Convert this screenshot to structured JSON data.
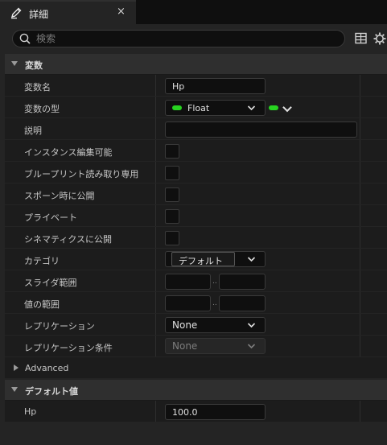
{
  "tab": {
    "title": "詳細",
    "close": "×"
  },
  "search": {
    "placeholder": "検索",
    "value": ""
  },
  "icons": {
    "tab": "pencil-icon",
    "search": "search-icon",
    "view": "grid-icon",
    "settings": "gear-icon"
  },
  "colors": {
    "accent_green": "#27d320",
    "background": "#242424",
    "row": "#1c1c1c"
  },
  "sections": {
    "variable": {
      "label": "変数"
    },
    "default": {
      "label": "デフォルト値"
    }
  },
  "props": {
    "name": {
      "label": "変数名",
      "value": "Hp"
    },
    "type": {
      "label": "変数の型",
      "value": "Float"
    },
    "desc": {
      "label": "説明",
      "value": ""
    },
    "instance_editable": {
      "label": "インスタンス編集可能"
    },
    "bp_readonly": {
      "label": "ブループリント読み取り専用"
    },
    "expose_spawn": {
      "label": "スポーン時に公開"
    },
    "private": {
      "label": "プライベート"
    },
    "expose_cinematics": {
      "label": "シネマティクスに公開"
    },
    "category": {
      "label": "カテゴリ",
      "value": "デフォルト"
    },
    "slider_range": {
      "label": "スライダ範囲",
      "min": "",
      "max": "",
      "sep": ".."
    },
    "value_range": {
      "label": "値の範囲",
      "min": "",
      "max": "",
      "sep": ".."
    },
    "replication": {
      "label": "レプリケーション",
      "value": "None"
    },
    "replication_condition": {
      "label": "レプリケーション条件",
      "value": "None"
    },
    "advanced": {
      "label": "Advanced"
    },
    "default_hp": {
      "label": "Hp",
      "value": "100.0"
    }
  }
}
